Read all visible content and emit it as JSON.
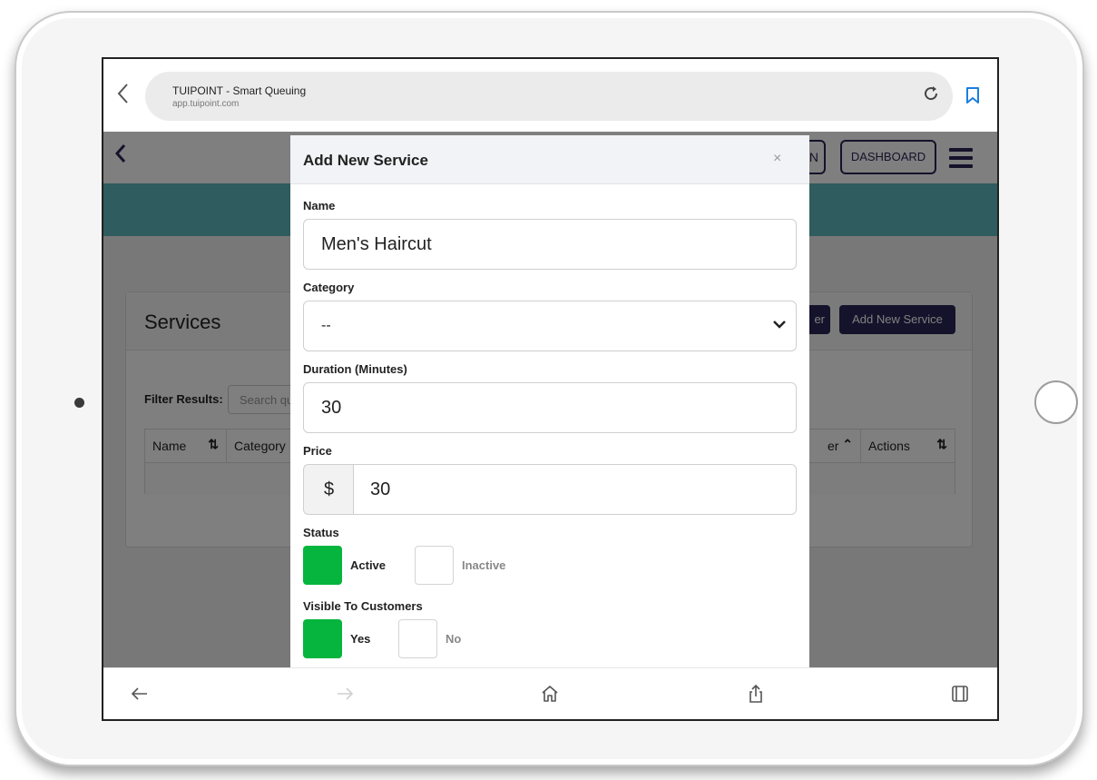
{
  "browser": {
    "page_title": "TUIPOINT - Smart Queuing",
    "host": "app.tuipoint.com"
  },
  "app": {
    "header": {
      "login_label_partial": "N",
      "dashboard_label": "DASHBOARD"
    },
    "services_card": {
      "title": "Services",
      "filter_button_partial": "er",
      "add_button_label": "Add New Service",
      "filter_label": "Filter Results:",
      "search_placeholder": "Search qu",
      "columns": [
        {
          "label": "Name"
        },
        {
          "label": "Category"
        },
        {
          "label": "er"
        },
        {
          "label": "Actions"
        }
      ]
    }
  },
  "modal": {
    "title": "Add New Service",
    "close_glyph": "×",
    "fields": {
      "name": {
        "label": "Name",
        "value": "Men's Haircut"
      },
      "category": {
        "label": "Category",
        "value": "--"
      },
      "duration": {
        "label": "Duration (Minutes)",
        "value": "30"
      },
      "price": {
        "label": "Price",
        "prefix": "$",
        "value": "30"
      }
    },
    "status": {
      "label": "Status",
      "options": [
        {
          "label": "Active",
          "selected": true
        },
        {
          "label": "Inactive",
          "selected": false
        }
      ]
    },
    "visible": {
      "label": "Visible To Customers",
      "options": [
        {
          "label": "Yes",
          "selected": true
        },
        {
          "label": "No",
          "selected": false
        }
      ]
    }
  },
  "colors": {
    "brand_navy": "#2b2456",
    "teal": "#5fb8bd",
    "active_green": "#06b53d",
    "bookmark_blue": "#1a7ee0"
  }
}
